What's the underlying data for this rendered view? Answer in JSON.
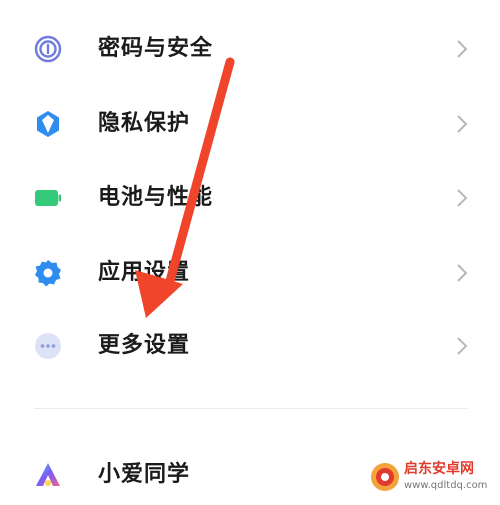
{
  "settings": {
    "items": [
      {
        "label": "密码与安全",
        "icon": "fingerprint-icon",
        "color": "#6f7bdc"
      },
      {
        "label": "隐私保护",
        "icon": "privacy-shield-icon",
        "color": "#2f8df0"
      },
      {
        "label": "电池与性能",
        "icon": "battery-icon",
        "color": "#35c97a"
      },
      {
        "label": "应用设置",
        "icon": "gear-icon",
        "color": "#2f8df0"
      },
      {
        "label": "更多设置",
        "icon": "more-dots-icon",
        "color": "#a9b4e8"
      },
      {
        "label": "小爱同学",
        "icon": "xiaoai-icon",
        "color": "#7b5cf0"
      }
    ]
  },
  "overlay": {
    "arrow_color": "#f0452a"
  },
  "watermark": {
    "title": "启东安卓网",
    "url": "www.qdltdq.com",
    "color": "#e23b2e"
  }
}
